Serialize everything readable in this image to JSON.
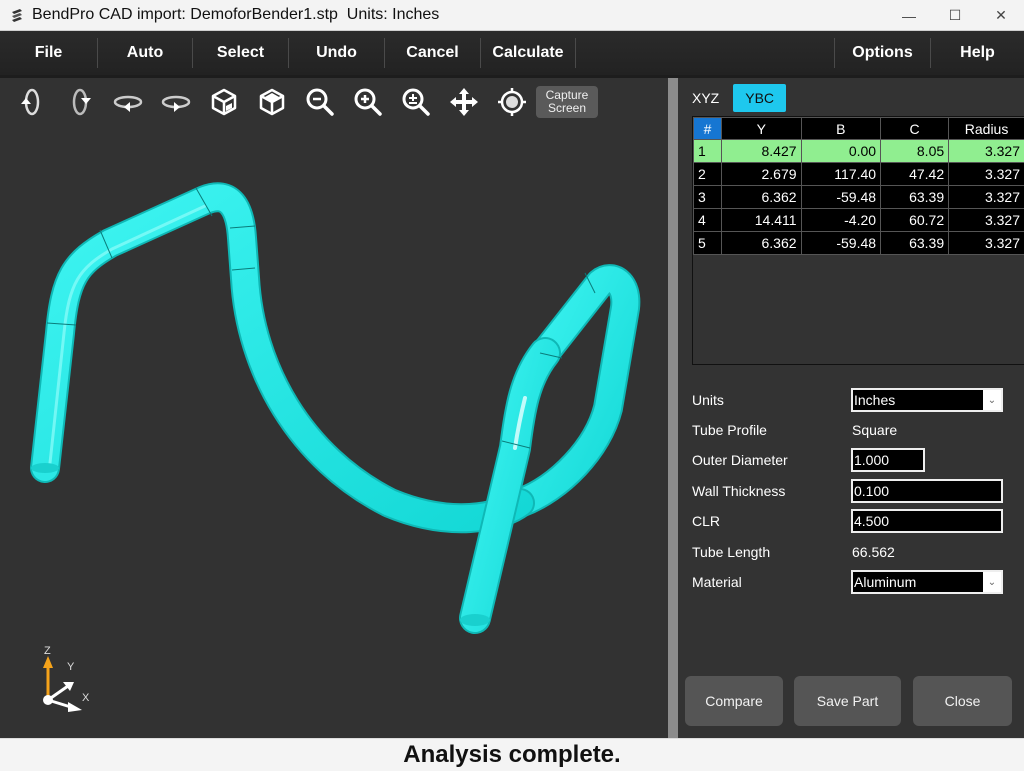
{
  "window": {
    "title": "BendPro CAD import: DemoforBender1.stp  Units: Inches",
    "app_icon": "bendpro-tube-icon",
    "controls": {
      "minimize": "—",
      "maximize": "☐",
      "close": "✕"
    }
  },
  "menu": {
    "items": [
      {
        "label": "File"
      },
      {
        "label": "Auto"
      },
      {
        "label": "Select"
      },
      {
        "label": "Undo"
      },
      {
        "label": "Cancel"
      },
      {
        "label": "Calculate"
      }
    ],
    "right_items": [
      {
        "label": "Options"
      },
      {
        "label": "Help"
      }
    ]
  },
  "toolbar": {
    "icons": [
      "rotate-x-ccw-icon",
      "rotate-x-cw-icon",
      "rotate-z-ccw-icon",
      "rotate-z-cw-icon",
      "view-front-cube-icon",
      "view-top-cube-icon",
      "zoom-out-icon",
      "zoom-in-icon",
      "zoom-fit-icon",
      "pan-icon",
      "center-view-icon"
    ],
    "capture_label_line1": "Capture",
    "capture_label_line2": "Screen"
  },
  "viewport": {
    "tube_color": "#1de9e6",
    "background": "#323232",
    "axes": {
      "z": "Z",
      "y": "Y",
      "x": "X"
    }
  },
  "panel": {
    "tabs": [
      {
        "label": "XYZ",
        "active": false
      },
      {
        "label": "YBC",
        "active": true
      }
    ],
    "grid": {
      "columns": [
        "#",
        "Y",
        "B",
        "C",
        "Radius"
      ],
      "rows": [
        {
          "idx": "1",
          "y": "8.427",
          "b": "0.00",
          "c": "8.05",
          "radius": "3.327",
          "selected": true
        },
        {
          "idx": "2",
          "y": "2.679",
          "b": "117.40",
          "c": "47.42",
          "radius": "3.327",
          "selected": false
        },
        {
          "idx": "3",
          "y": "6.362",
          "b": "-59.48",
          "c": "63.39",
          "radius": "3.327",
          "selected": false
        },
        {
          "idx": "4",
          "y": "14.411",
          "b": "-4.20",
          "c": "60.72",
          "radius": "3.327",
          "selected": false
        },
        {
          "idx": "5",
          "y": "6.362",
          "b": "-59.48",
          "c": "63.39",
          "radius": "3.327",
          "selected": false
        }
      ]
    },
    "properties": {
      "units_label": "Units",
      "units_value": "Inches",
      "profile_label": "Tube Profile",
      "profile_value": "Square",
      "od_label": "Outer Diameter",
      "od_value": "1.000",
      "wall_label": "Wall Thickness",
      "wall_value": "0.100",
      "clr_label": "CLR",
      "clr_value": "4.500",
      "length_label": "Tube Length",
      "length_value": "66.562",
      "material_label": "Material",
      "material_value": "Aluminum"
    },
    "buttons": {
      "compare": "Compare",
      "save_part": "Save Part",
      "close": "Close"
    }
  },
  "status": {
    "text": "Analysis complete."
  },
  "colors": {
    "accent_tab": "#1ec8ee",
    "selected_row": "#90ee90",
    "header_hash": "#1676d2",
    "tube": "#1de9e6"
  }
}
